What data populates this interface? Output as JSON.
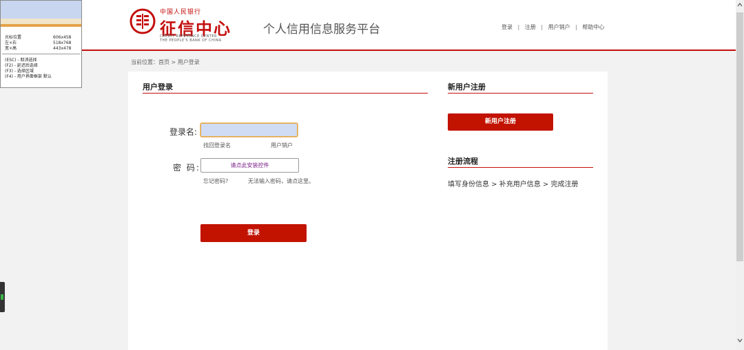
{
  "header": {
    "logo": {
      "top_text": "中国人民银行",
      "title": "征信中心",
      "en_line1": "CREDIT REFERENCE CENTER",
      "en_line2": "THE PEOPLE'S BANK OF CHINA"
    },
    "platform_title": "个人信用信息服务平台",
    "links": {
      "login": "登录",
      "register": "注册",
      "cancel_account": "用户销户",
      "help": "帮助中心",
      "separator": "|"
    }
  },
  "breadcrumb": "当前位置：首页 > 用户登录",
  "login": {
    "section_title": "用户登录",
    "username_label": "登录名:",
    "username_value": "",
    "find_username_link": "找回登录名",
    "cancel_account_link": "用户销户",
    "password_label": "密  码:",
    "install_control_text": "请点此安装控件",
    "forgot_password_link": "忘记密码?",
    "cannot_input_link": "无法输入密码，请点这里。",
    "login_button": "登录"
  },
  "register": {
    "section_title": "新用户注册",
    "button": "新用户注册",
    "flow_title": "注册流程",
    "flow_text": "填写身份信息 > 补充用户信息 > 完成注册"
  },
  "overlay": {
    "rows": [
      {
        "label": "光标位置",
        "value": "606x458"
      },
      {
        "label": "左×右",
        "value": "518x768"
      },
      {
        "label": "宽×高",
        "value": "443x478"
      }
    ],
    "hints": [
      "(ESC) - 取消选择",
      "(F2)  - 延迟后选择",
      "(F3)  - 选择区域",
      "(F4)  - 用户界面框架 默认"
    ]
  },
  "scrollbar": {
    "up_icon": "chevron-up-icon",
    "down_icon": "chevron-down-icon"
  },
  "colors": {
    "brand_red": "#c40d0d",
    "button_red": "#c21200",
    "input_fill": "#cfdcf3"
  }
}
